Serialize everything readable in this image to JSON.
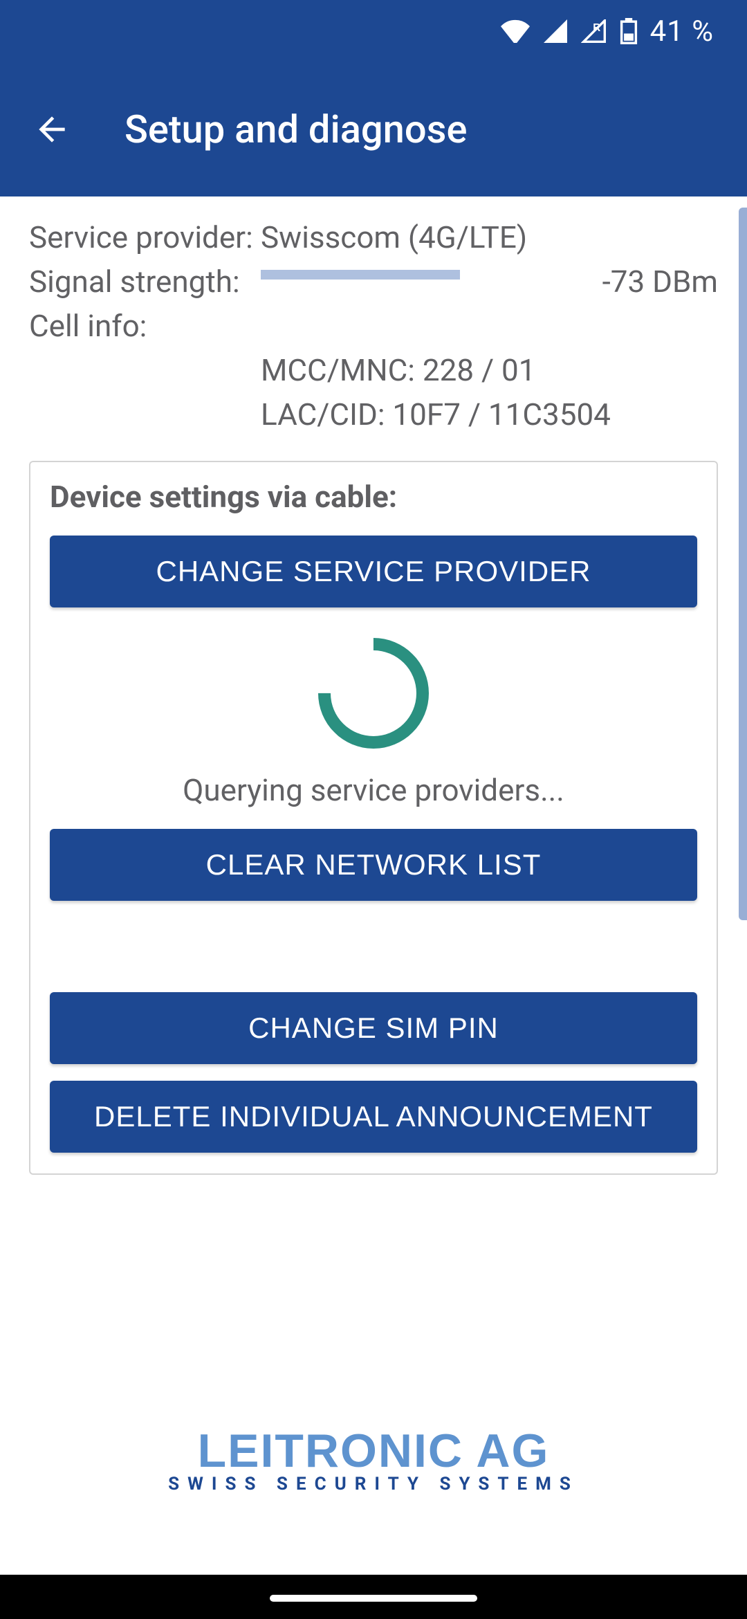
{
  "status": {
    "battery_text": "41 %"
  },
  "appbar": {
    "title": "Setup and diagnose"
  },
  "info": {
    "label_provider": "Service provider:",
    "provider_value": "Swisscom (4G/LTE)",
    "label_signal": "Signal strength:",
    "signal_pct": 65,
    "signal_dbm": "-73 DBm",
    "label_cellinfo": "Cell info:",
    "mccmnc": "MCC/MNC: 228 / 01",
    "laccid": "LAC/CID: 10F7 / 11C3504"
  },
  "card": {
    "title": "Device settings via cable:",
    "btn_change_provider": "CHANGE SERVICE PROVIDER",
    "querying_text": "Querying service providers...",
    "btn_clear_network": "CLEAR NETWORK LIST",
    "btn_change_sim_pin": "CHANGE SIM PIN",
    "btn_delete_announcement": "DELETE INDIVIDUAL ANNOUNCEMENT"
  },
  "brand": {
    "line1": "LEITRONIC AG",
    "line2": "SWISS SECURITY SYSTEMS"
  }
}
